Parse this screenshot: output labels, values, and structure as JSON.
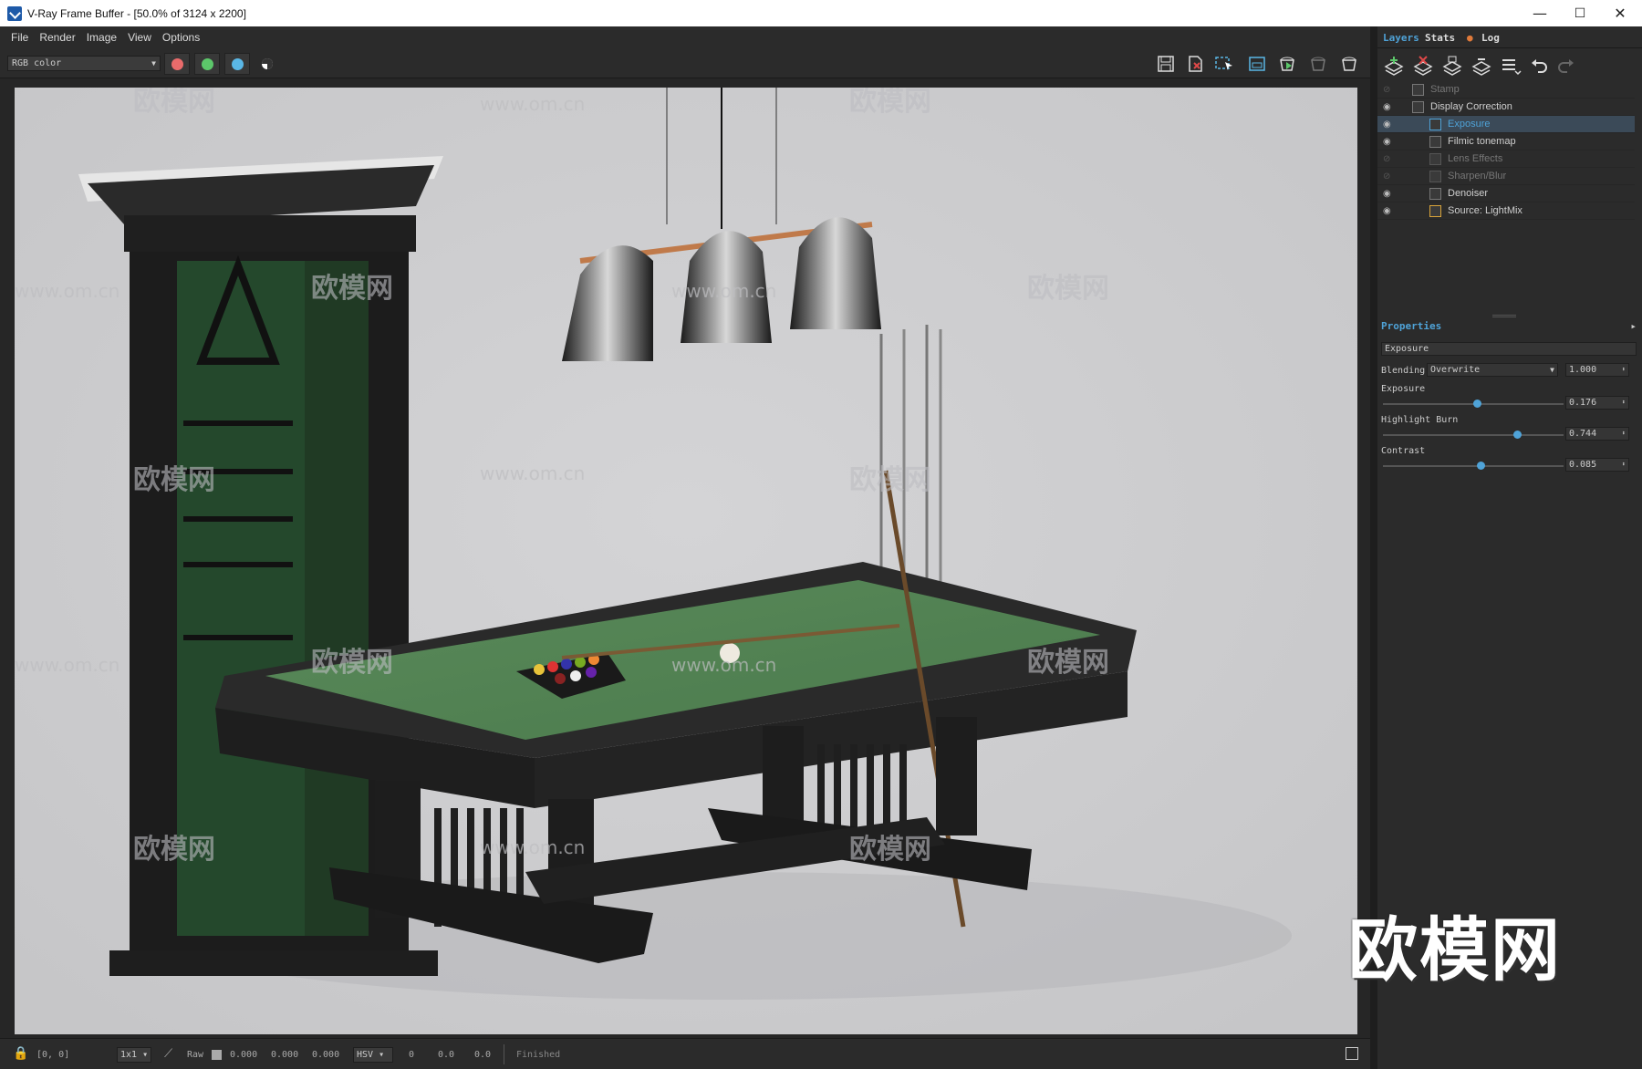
{
  "window": {
    "title": "V-Ray Frame Buffer - [50.0% of 3124 x 2200]",
    "minimize": "—",
    "maximize": "☐",
    "close": "✕"
  },
  "menu": [
    "File",
    "Render",
    "Image",
    "View",
    "Options"
  ],
  "toolbar": {
    "channel": "RGB color",
    "channel_colors": {
      "red": "#e96b6b",
      "green": "#5cc76a",
      "blue": "#5ab7e6"
    }
  },
  "tabs": {
    "layers": "Layers",
    "stats": "Stats",
    "log": "Log"
  },
  "layers": [
    {
      "name": "Stamp",
      "visible": false
    },
    {
      "name": "Display Correction",
      "visible": true
    },
    {
      "name": "Exposure",
      "visible": true,
      "selected": true
    },
    {
      "name": "Filmic tonemap",
      "visible": true
    },
    {
      "name": "Lens Effects",
      "visible": false
    },
    {
      "name": "Sharpen/Blur",
      "visible": false
    },
    {
      "name": "Denoiser",
      "visible": true
    },
    {
      "name": "Source: LightMix",
      "visible": true
    }
  ],
  "properties": {
    "header": "Properties",
    "layer_name": "Exposure",
    "blending_label": "Blending",
    "blending_mode": "Overwrite",
    "blending_value": "1.000",
    "exposure_label": "Exposure",
    "exposure_value": "0.176",
    "exposure_level": 0.52,
    "highlight_label": "Highlight Burn",
    "highlight_value": "0.744",
    "highlight_level": 0.74,
    "contrast_label": "Contrast",
    "contrast_value": "0.085",
    "contrast_level": 0.54
  },
  "status": {
    "coords": "[0, 0]",
    "zoom": "1x1",
    "raw_label": "Raw",
    "raw_values": [
      "0.000",
      "0.000",
      "0.000"
    ],
    "color_space": "HSV",
    "hsv_values": [
      "0",
      "0.0",
      "0.0"
    ],
    "state": "Finished"
  },
  "watermarks": {
    "cn": "欧模网",
    "url": "www.om.cn",
    "big": "欧模网"
  }
}
